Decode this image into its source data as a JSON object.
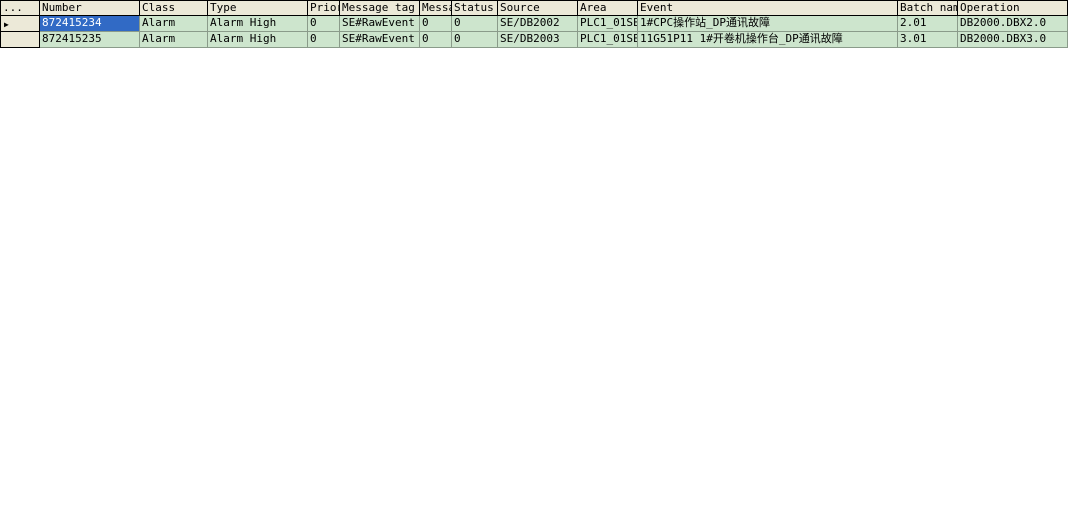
{
  "columns": [
    {
      "label": "..."
    },
    {
      "label": "Number"
    },
    {
      "label": "Class"
    },
    {
      "label": "Type"
    },
    {
      "label": "Priority"
    },
    {
      "label": "Message tag"
    },
    {
      "label": "Message"
    },
    {
      "label": "Status text"
    },
    {
      "label": "Source"
    },
    {
      "label": "Area"
    },
    {
      "label": "Event"
    },
    {
      "label": "Batch name"
    },
    {
      "label": "Operation"
    }
  ],
  "rows": [
    {
      "active": true,
      "selected_col": 1,
      "cells": [
        "",
        "872415234",
        "Alarm",
        "Alarm High",
        "0",
        "SE#RawEvent",
        "0",
        "0",
        "SE/DB2002",
        "PLC1_01SE",
        "1#CPC操作站_DP通讯故障",
        "2.01",
        "DB2000.DBX2.0"
      ]
    },
    {
      "active": false,
      "selected_col": -1,
      "cells": [
        "",
        "872415235",
        "Alarm",
        "Alarm High",
        "0",
        "SE#RawEvent",
        "0",
        "0",
        "SE/DB2003",
        "PLC1_01SE",
        "11G51P11 1#开卷机操作台_DP通讯故障",
        "3.01",
        "DB2000.DBX3.0"
      ]
    }
  ]
}
